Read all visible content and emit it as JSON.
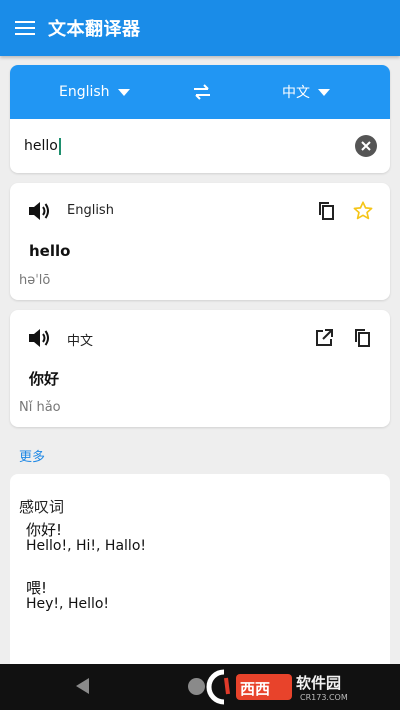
{
  "app": {
    "title": "文本翻译器"
  },
  "languages": {
    "source": "English",
    "target": "中文"
  },
  "input": {
    "value": "hello"
  },
  "source_card": {
    "lang": "English",
    "word": "hello",
    "phonetic": "həˈlō"
  },
  "target_card": {
    "lang": "中文",
    "word": "你好",
    "phonetic": "Nǐ hǎo"
  },
  "more_label": "更多",
  "dictionary": {
    "part_of_speech": "感叹词",
    "entries": [
      {
        "word": "你好!",
        "translations": "Hello!, Hi!, Hallo!"
      },
      {
        "word": "喂!",
        "translations": "Hey!, Hello!"
      }
    ]
  },
  "watermark": {
    "brand": "西西软件园",
    "site": "CR173.COM"
  },
  "colors": {
    "appbar": "#1a8ce8",
    "lang_bar": "#2196f3",
    "link": "#1e88e5",
    "star": "#f5c518"
  },
  "icons": [
    "menu-icon",
    "swap-icon",
    "chevron-down-icon",
    "clear-icon",
    "speaker-icon",
    "copy-icon",
    "star-icon",
    "open-external-icon",
    "back-icon",
    "home-icon"
  ]
}
